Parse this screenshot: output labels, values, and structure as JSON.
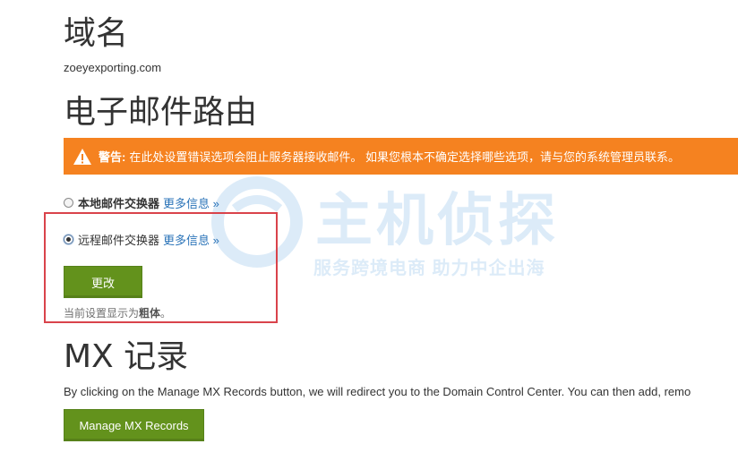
{
  "domain_section": {
    "heading": "域名",
    "domain": "zoeyexporting.com"
  },
  "routing_section": {
    "heading": "电子邮件路由",
    "warning": {
      "label": "警告:",
      "message": "在此处设置错误选项会阻止服务器接收邮件。 如果您根本不确定选择哪些选项，请与您的系统管理员联系。"
    },
    "options": [
      {
        "label": "本地邮件交换器",
        "more": "更多信息 »",
        "checked": false
      },
      {
        "label": "远程邮件交换器",
        "more": "更多信息 »",
        "checked": true
      }
    ],
    "change_button": "更改",
    "note_prefix": "当前设置显示为",
    "note_bold": "粗体",
    "note_suffix": "。"
  },
  "mx_section": {
    "heading": "MX 记录",
    "description": "By clicking on the Manage MX Records button, we will redirect you to the Domain Control Center. You can then add, remo",
    "manage_button": "Manage MX Records"
  },
  "watermark": {
    "main": "主机侦探",
    "sub": "服务跨境电商 助力中企出海"
  },
  "colors": {
    "warning_bg": "#f58220",
    "button_green": "#63921c",
    "link_blue": "#2a73b8",
    "highlight_red": "#d9434b"
  }
}
